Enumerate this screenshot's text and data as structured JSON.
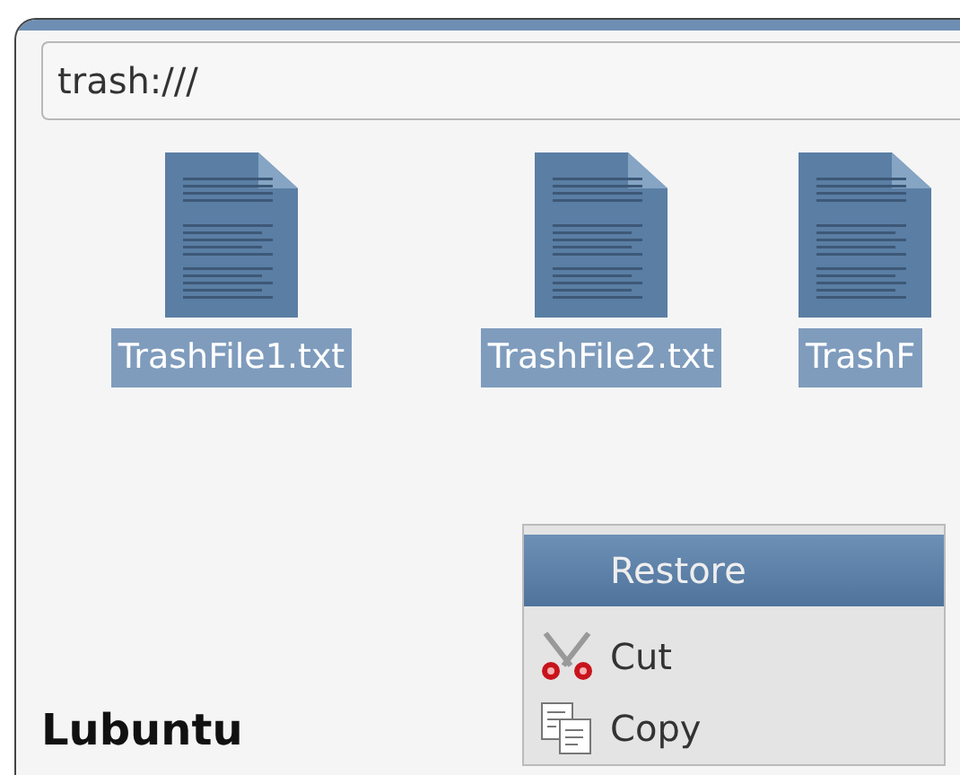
{
  "address_bar": {
    "value": "trash:///"
  },
  "files": [
    {
      "name": "TrashFile1.txt",
      "selected": true
    },
    {
      "name": "TrashFile2.txt",
      "selected": true
    },
    {
      "name": "TrashF",
      "selected": true
    }
  ],
  "context_menu": {
    "items": [
      {
        "kind": "header",
        "label": "Restore",
        "selected": true
      },
      {
        "kind": "cut",
        "label": "Cut",
        "selected": false
      },
      {
        "kind": "copy",
        "label": "Copy",
        "selected": false
      }
    ]
  },
  "caption": "Lubuntu"
}
